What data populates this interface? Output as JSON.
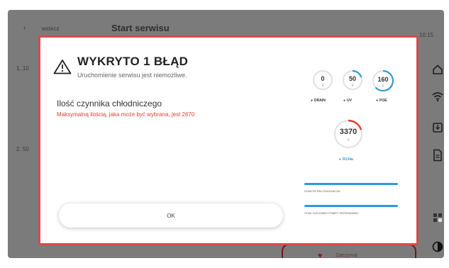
{
  "background": {
    "back_glyph": "‹",
    "crumb": "wstecz",
    "title": "Start serwisu",
    "time": "10:15",
    "row1": "1. 10",
    "row2": "2. 50",
    "footer_button_icon": "heart-icon",
    "footer_button_text": "Zatrzymaj"
  },
  "sidebar": {
    "icons": [
      "home-icon",
      "wifi-icon",
      "download-icon",
      "document-icon",
      "grid-icon",
      "contrast-icon"
    ]
  },
  "modal": {
    "icon": "warning-icon",
    "title": "WYKRYTO 1 BŁĄD",
    "subtitle": "Uruchomienie serwisu jest niemożliwe.",
    "field_label": "Ilość czynnika chłodniczego",
    "field_error": "Maksymalną ilością, jaka może być wybrana, jest 2670",
    "ok_label": "OK",
    "border_color": "#d94a4a",
    "error_color": "#e0402f"
  },
  "gauges": {
    "drain": {
      "value": "0",
      "unit": "g",
      "caption": "DRAIN",
      "fill": 0
    },
    "uv": {
      "value": "50",
      "unit": "g",
      "caption": "UV",
      "fill": 0.3
    },
    "poe": {
      "value": "160",
      "unit": "g",
      "caption": "POE",
      "fill": 0.65
    },
    "r134a": {
      "value": "3370",
      "unit": "g",
      "caption": "R134a",
      "fill": 0.3
    }
  },
  "status_bars": [
    {
      "label": "STAN FILTRA OSUSZACZA",
      "fill": 1.0
    },
    {
      "label": "STAN OLEJOWEJ POMPY PRÓŻNIOWEJ",
      "fill": 1.0
    }
  ],
  "colors": {
    "accent_blue": "#2e9bd6",
    "accent_red": "#e0402f"
  }
}
